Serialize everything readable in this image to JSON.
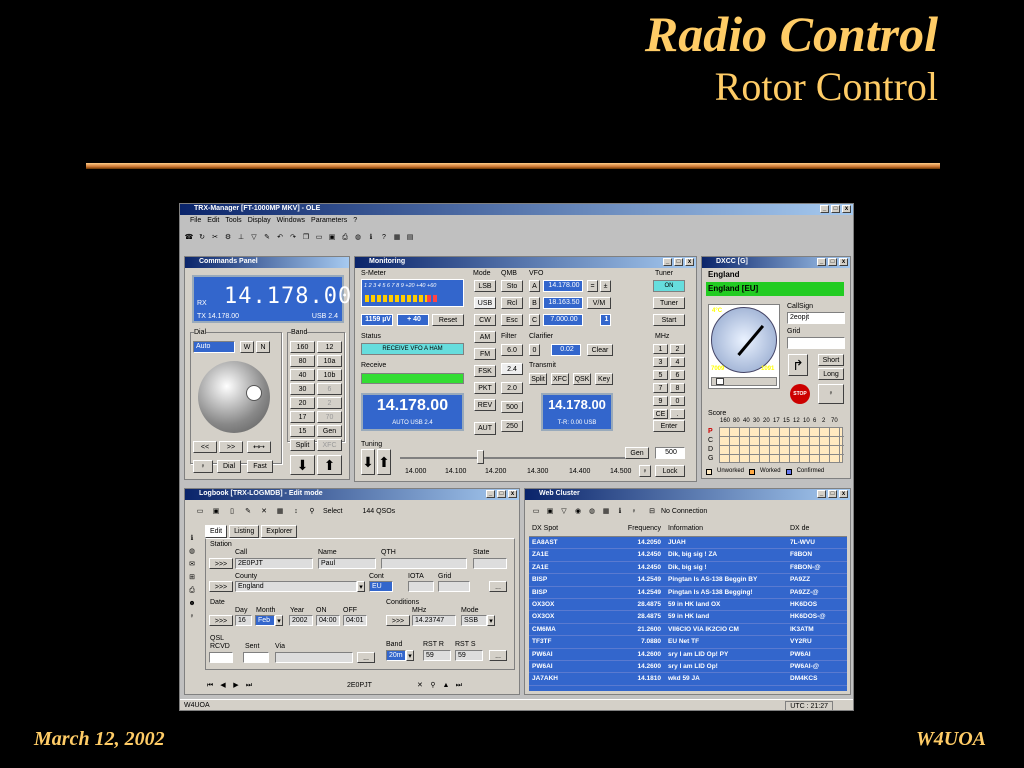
{
  "slide": {
    "title": "Radio Control",
    "subtitle": "Rotor Control",
    "date": "March 12, 2002",
    "callsign": "W4UOA"
  },
  "app": {
    "title": "TRX-Manager [FT-1000MP MKV] - OLE",
    "menu": [
      "File",
      "Edit",
      "Tools",
      "Display",
      "Windows",
      "Parameters",
      "?"
    ],
    "status_left": "W4UOA",
    "status_utc": "UTC : 21:27"
  },
  "commands": {
    "title": "Commands Panel",
    "rx": "RX",
    "freq_main": "14.178.00",
    "tx": "TX 14.178.00",
    "mode": "USB 2.4",
    "dial_label": "Dial",
    "dial_value": "Auto",
    "w": "W",
    "n": "N",
    "band_label": "Band",
    "bands": [
      "160",
      "12",
      "80",
      "10a",
      "40",
      "10b",
      "30",
      "6",
      "20",
      "2",
      "17",
      "70",
      "15",
      "Gen"
    ],
    "split": "Split",
    "xfc": "XFC",
    "prev": "<<",
    "next": ">>",
    "dial_btn": "Dial",
    "fast": "Fast"
  },
  "monitoring": {
    "title": "Monitoring",
    "smeter_label": "S-Meter",
    "smeter_scale": "1 2 3 4 5 6 7 8 9 +20 +40 +60",
    "uv": "1159 µV",
    "db": "+ 40",
    "reset": "Reset",
    "status_label": "Status",
    "status_text": "RECEIVE VFO A HAM",
    "receive_label": "Receive",
    "rx_freq": "14.178.00",
    "rx_mode": "AUTO USB 2.4",
    "mode_label": "Mode",
    "modes": [
      "LSB",
      "USB",
      "CW",
      "AM",
      "FM",
      "FSK",
      "PKT",
      "REV"
    ],
    "qmb_label": "QMB",
    "qmb": [
      "Sto",
      "Rcl",
      "Esc"
    ],
    "filter_label": "Filter",
    "filters": [
      "6.0",
      "2.4",
      "2.0",
      "500",
      "250"
    ],
    "aut": "AUT",
    "vfo_label": "VFO",
    "vfo": [
      "A",
      "B",
      "C"
    ],
    "vfo_vals": [
      "14.178.00",
      "18.163.50",
      "7.000.00"
    ],
    "vm": "V/M",
    "clarifier_label": "Clarifier",
    "clar_val": "0",
    "clar_shift": "0.02",
    "clear": "Clear",
    "transmit_label": "Transmit",
    "tx_btns": [
      "Split",
      "XFC",
      "QSK",
      "Key"
    ],
    "tx_freq": "14.178.00",
    "tx_sub": "T-R: 0.00 USB",
    "tuner_label": "Tuner",
    "tuner_on": "ON",
    "tuner": "Tuner",
    "start": "Start",
    "mhz_label": "MHz",
    "mhz": [
      "1",
      "2",
      "3",
      "4",
      "5",
      "6",
      "7",
      "8",
      "9",
      "0",
      "CE",
      "."
    ],
    "enter": "Enter",
    "tuning_label": "Tuning",
    "tuning_ticks": [
      "14.000",
      "14.100",
      "14.200",
      "14.300",
      "14.400",
      "14.500"
    ],
    "gen": "Gen",
    "gen_val": "500",
    "lock": "Lock"
  },
  "dxcc": {
    "title": "DXCC [G]",
    "country": "England",
    "country_code": "England [EU]",
    "callsign_label": "CallSign",
    "callsign": "2eopjt",
    "grid_label": "Grid",
    "short": "Short",
    "long": "Long",
    "stop": "STOP",
    "lon_left": "4°C",
    "lon_right": "1091",
    "val_left": "7009",
    "score_label": "Score",
    "score_bands": [
      "160",
      "80",
      "40",
      "30",
      "20",
      "17",
      "15",
      "12",
      "10",
      "6",
      "2",
      "70"
    ],
    "score_rows": [
      "P",
      "C",
      "D",
      "G"
    ],
    "legend": [
      "Unworked",
      "Worked",
      "Confirmed"
    ]
  },
  "logbook": {
    "title": "Logbook [TRX-LOGMDB] - Edit mode",
    "qsos": "144 QSOs",
    "select": "Select",
    "tabs": [
      "Edit",
      "Listing",
      "Explorer"
    ],
    "station_label": "Station",
    "call_label": "Call",
    "call": "2E0PJT",
    "name_label": "Name",
    "name": "Paul",
    "qth_label": "QTH",
    "state_label": "State",
    "country_label": "County",
    "country": "England",
    "cont_label": "Cont",
    "cont": "EU",
    "iota_label": "IOTA",
    "grid_label": "Grid",
    "date_label": "Date",
    "day_label": "Day",
    "day": "16",
    "month_label": "Month",
    "month": "Feb",
    "year_label": "Year",
    "year": "2002",
    "on_label": "ON",
    "on": "04:00",
    "off_label": "OFF",
    "off": "04:01",
    "cond_label": "Conditions",
    "mhz_label": "MHz",
    "mhz": "14.23747",
    "mode_label": "Mode",
    "mode": "SSB",
    "qsl_label": "QSL",
    "rcvd_label": "RCVD",
    "sent_label": "Sent",
    "via_label": "Via",
    "band_label": "Band",
    "band": "20m",
    "rstr_label": "RST R",
    "rstr": "59",
    "rsts_label": "RST S",
    "rsts": "59",
    "nav_call": "2E0PJT",
    "go": ">>>",
    "more": "..."
  },
  "cluster": {
    "title": "Web Cluster",
    "noconn": "No Connection",
    "headers": [
      "DX Spot",
      "Frequency",
      "Information",
      "DX de"
    ],
    "rows": [
      [
        "EA8AST",
        "14.2050",
        "JUAH",
        "7L-WVU"
      ],
      [
        "ZA1E",
        "14.2450",
        "Dik, big sig !          ZA",
        "F8BON"
      ],
      [
        "ZA1E",
        "14.2450",
        "Dik, big sig !",
        "F8BON-@"
      ],
      [
        "BISP",
        "14.2549",
        "Pingtan Is AS-138 Beggin   BY",
        "PA9ZZ"
      ],
      [
        "BISP",
        "14.2549",
        "Pingtan Is AS-138 Begging!",
        "PA9ZZ-@"
      ],
      [
        "OX3OX",
        "28.4875",
        "59 in HK land            OX",
        "HK6DOS"
      ],
      [
        "OX3OX",
        "28.4875",
        "59 in HK land",
        "HK6DOS-@"
      ],
      [
        "CM6MA",
        "21.2600",
        "VII6CIO   VIA IK2CIO     CM",
        "IK3ATM"
      ],
      [
        "TF3TF",
        "7.0880",
        "EU Net                    TF",
        "VY2RU"
      ],
      [
        "PW6AI",
        "14.2600",
        "sry I am LID Op!          PY",
        "PW6AI"
      ],
      [
        "PW6AI",
        "14.2600",
        "sry I am LID Op!",
        "PW6AI-@"
      ],
      [
        "JA7AKH",
        "14.1810",
        "wkd 59                    JA",
        "DM4KCS"
      ]
    ]
  }
}
